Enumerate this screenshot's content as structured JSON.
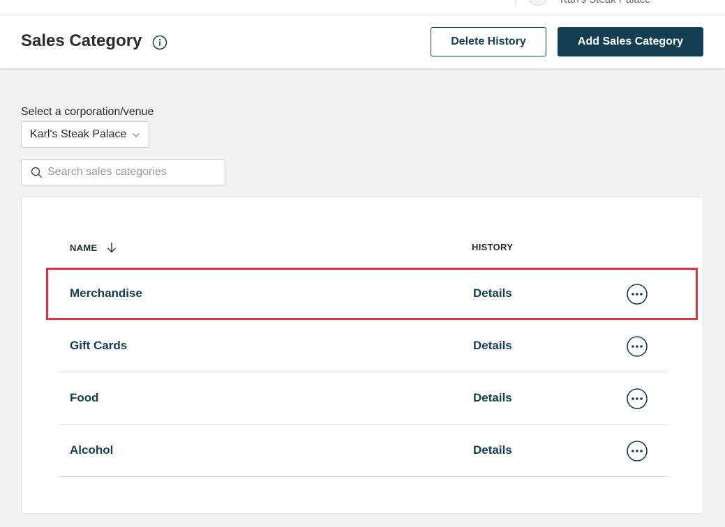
{
  "topbar": {
    "venue_name": "Karl's Steak Palace"
  },
  "header": {
    "title": "Sales Category",
    "delete_history_label": "Delete History",
    "add_category_label": "Add Sales Category"
  },
  "filters": {
    "venue_label": "Select a corporation/venue",
    "venue_selected": "Karl's Steak Palace",
    "search_placeholder": "Search sales categories"
  },
  "table": {
    "columns": {
      "name": "NAME",
      "history": "HISTORY"
    },
    "rows": [
      {
        "name": "Merchandise",
        "history": "Details"
      },
      {
        "name": "Gift Cards",
        "history": "Details"
      },
      {
        "name": "Food",
        "history": "Details"
      },
      {
        "name": "Alcohol",
        "history": "Details"
      }
    ]
  },
  "icons": {
    "info": "info-icon",
    "sort": "arrow-down-icon",
    "search": "search-icon",
    "select": "chevron-down-icon",
    "row_actions": "more-horizontal-icon"
  },
  "colors": {
    "primary": "#123f52",
    "highlight": "#e0313f",
    "background": "#f2f2f2"
  }
}
